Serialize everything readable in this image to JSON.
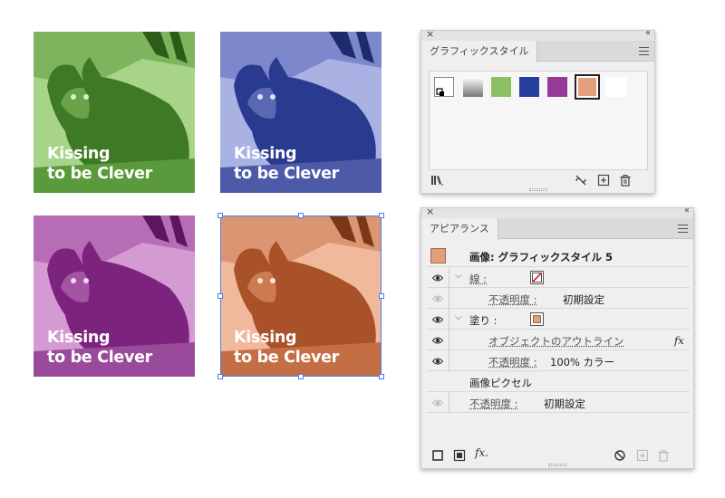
{
  "artwork": {
    "caption_line1": "Kissing",
    "caption_line2": "to be Clever",
    "tiles": [
      {
        "name": "green",
        "dark": "#3e7a24",
        "light": "#a8d48a"
      },
      {
        "name": "blue",
        "dark": "#2a3a8e",
        "light": "#a9b2e3"
      },
      {
        "name": "purple",
        "dark": "#7c237e",
        "light": "#d49ad2"
      },
      {
        "name": "orange",
        "dark": "#a9522a",
        "light": "#f1b99c"
      }
    ]
  },
  "graphic_styles_panel": {
    "tab_label": "グラフィックスタイル",
    "swatch_colors": [
      "#ffffff",
      "gradient",
      "#8dc063",
      "#263f9c",
      "#963c98",
      "#e2a07a"
    ],
    "footer_icons": [
      "library-icon",
      "break-link-icon",
      "new-style-icon",
      "trash-icon"
    ]
  },
  "appearance_panel": {
    "tab_label": "アピアランス",
    "header_title": "画像: グラフィックスタイル 5",
    "header_color": "#e2a07a",
    "stroke_label": "線 :",
    "stroke_opacity_label": "不透明度 :",
    "stroke_opacity_value": "初期設定",
    "fill_label": "塗り :",
    "fill_color": "#e2a07a",
    "effect_label": "オブジェクトのアウトライン",
    "effect_fx": "fx",
    "fill_opacity_label": "不透明度 :",
    "fill_opacity_value": "100% カラー",
    "pixel_label": "画像ピクセル",
    "object_opacity_label": "不透明度 :",
    "object_opacity_value": "初期設定",
    "footer_fx": "fx."
  },
  "colors": {
    "selection": "#4a7df0"
  }
}
